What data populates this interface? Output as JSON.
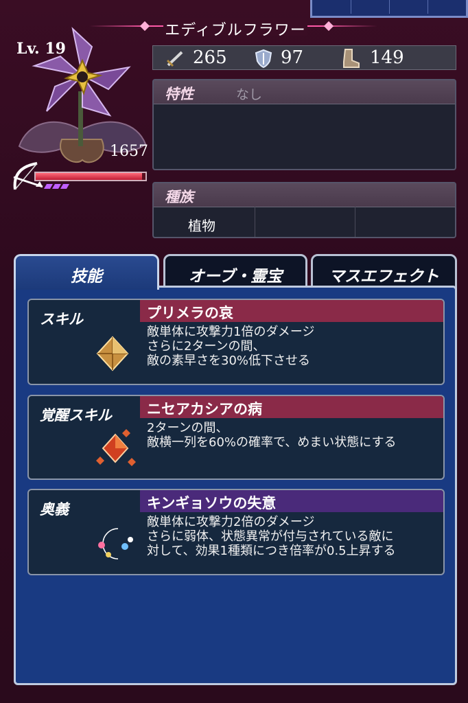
{
  "unit": {
    "name": "エディブルフラワー",
    "level_label": "Lv. 19",
    "hp": "1657",
    "hp_fill": 0.97
  },
  "stats": {
    "attack": "265",
    "defense": "97",
    "speed": "149"
  },
  "trait": {
    "title": "特性",
    "value": "なし"
  },
  "race": {
    "title": "種族",
    "value": "植物"
  },
  "tabs": [
    {
      "label": "技能",
      "active": true
    },
    {
      "label": "オーブ・霊宝",
      "active": false
    },
    {
      "label": "マスエフェクト",
      "active": false
    }
  ],
  "skills": [
    {
      "type": "スキル",
      "name": "プリメラの哀",
      "lines": [
        "敵単体に攻撃力1倍のダメージ",
        "さらに2ターンの間、",
        "敵の素早さを30%低下させる"
      ],
      "bar_color": "#8a2a48",
      "icon": "single-diamond-gem-icon"
    },
    {
      "type": "覚醒スキル",
      "name": "ニセアカシアの病",
      "lines": [
        "2ターンの間、",
        "敵横一列を60%の確率で、めまい状態にする"
      ],
      "bar_color": "#8a2a48",
      "icon": "cluster-diamond-gem-icon"
    },
    {
      "type": "奥義",
      "name": "キンギョソウの失意",
      "lines": [
        "敵単体に攻撃力2倍のダメージ",
        "さらに弱体、状態異常が付与されている敵に",
        "対して、効果1種類につき倍率が0.5上昇する"
      ],
      "bar_color": "#4a2a7a",
      "icon": "crescent-moon-icon"
    }
  ],
  "colors": {
    "background": "#2e0a1e",
    "content_blue": "#193a82",
    "hp_red": "#c01c35",
    "awakening_pips": "#c060ff"
  }
}
